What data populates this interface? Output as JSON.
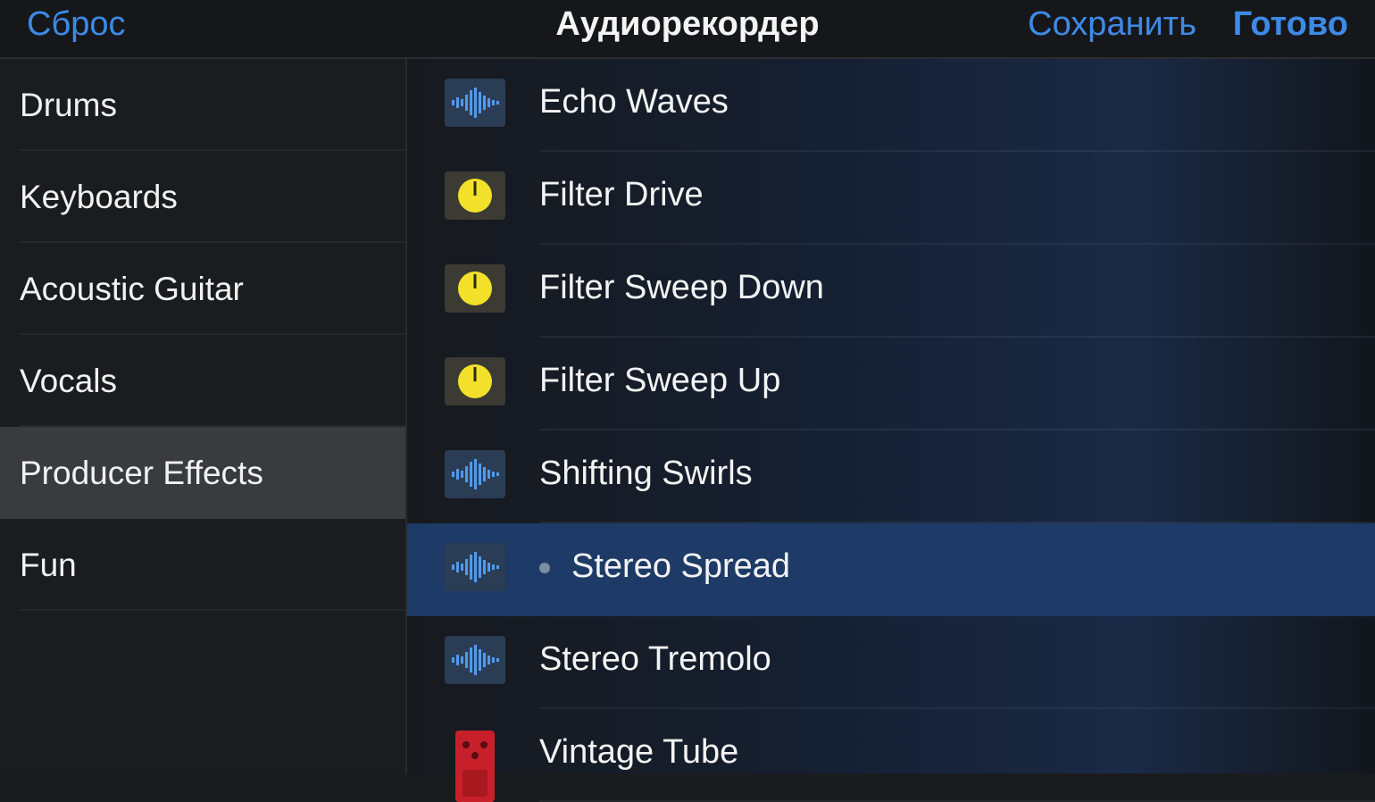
{
  "header": {
    "reset_label": "Сброс",
    "title": "Аудиорекордер",
    "save_label": "Сохранить",
    "done_label": "Готово"
  },
  "sidebar": {
    "items": [
      {
        "label": "Drums"
      },
      {
        "label": "Keyboards"
      },
      {
        "label": "Acoustic Guitar"
      },
      {
        "label": "Vocals"
      },
      {
        "label": "Producer Effects",
        "active": true
      },
      {
        "label": "Fun"
      }
    ]
  },
  "presets": {
    "items": [
      {
        "label": "Echo Waves",
        "icon": "waveform-icon"
      },
      {
        "label": "Filter Drive",
        "icon": "knob-icon"
      },
      {
        "label": "Filter Sweep Down",
        "icon": "knob-icon"
      },
      {
        "label": "Filter Sweep Up",
        "icon": "knob-icon"
      },
      {
        "label": "Shifting Swirls",
        "icon": "waveform-icon"
      },
      {
        "label": "Stereo Spread",
        "icon": "waveform-icon",
        "selected": true
      },
      {
        "label": "Stereo Tremolo",
        "icon": "waveform-icon"
      },
      {
        "label": "Vintage Tube",
        "icon": "pedal-icon"
      }
    ]
  },
  "colors": {
    "accent": "#3d8ae6",
    "selected_row": "#1d3b66",
    "knob_yellow": "#f2e02a",
    "pedal_red": "#c8202a"
  }
}
